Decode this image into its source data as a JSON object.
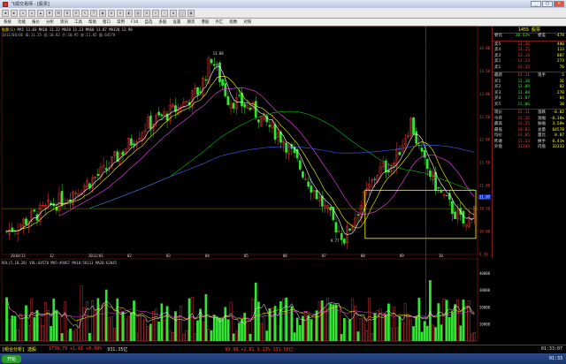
{
  "window": {
    "title": "飞狐交易师 - [股票]",
    "min": "_",
    "max": "□",
    "close": "×"
  },
  "toolbar": {
    "buttons": [
      "◀",
      "▶",
      "⌂",
      "↻",
      "▲",
      "▼",
      "☰",
      "⊞",
      "⊟",
      "✎",
      "?",
      "▣",
      "⊕",
      "⊖",
      "◧",
      "▤",
      "⊡",
      "✦",
      "☆",
      "⚙",
      "□",
      "▦"
    ]
  },
  "menu": {
    "items": [
      "系统",
      "功能",
      "报价",
      "分析",
      "资讯",
      "工具",
      "帮助",
      "窗口",
      "常用",
      "F10",
      "自选",
      "多股",
      "设置",
      "期货",
      "港股",
      "外汇",
      "指数",
      "对照"
    ]
  },
  "indicator_top": {
    "name": "股票(1)",
    "values": "MA5 11.03  MA10 11.22  MA20 11.13  MA60 11.87  MA120 12.98"
  },
  "indicator_sub": {
    "values": "2011/08/06 高:11.25 低:10.83 开:10.95 收:11.05 量:64578"
  },
  "volume_info": {
    "values": "VOL(5,10,20) VOL:64578 MA5:49467 MA10:56113 MA20:62045"
  },
  "chart_labels": {
    "peak": "13.88",
    "low": "9.77",
    "highlight": "11.97"
  },
  "right_panel": {
    "header": "1455 股票",
    "rows": [
      {
        "k": "委比",
        "v": "-30.03%",
        "e": "委差",
        "x": "-478"
      },
      {
        "k": "卖5",
        "v": "11.16",
        "e": "",
        "x": "480"
      },
      {
        "k": "卖4",
        "v": "11.15",
        "e": "",
        "x": "113"
      },
      {
        "k": "卖3",
        "v": "11.14",
        "e": "",
        "x": "887"
      },
      {
        "k": "卖2",
        "v": "11.13",
        "e": "",
        "x": "273"
      },
      {
        "k": "卖1",
        "v": "11.12",
        "e": "",
        "x": "76"
      },
      {
        "k": "最新",
        "v": "11.11",
        "e": "现手",
        "x": "5"
      },
      {
        "k": "买1",
        "v": "11.10",
        "e": "",
        "x": "31"
      },
      {
        "k": "买2",
        "v": "11.09",
        "e": "",
        "x": "82"
      },
      {
        "k": "买3",
        "v": "11.08",
        "e": "",
        "x": "270"
      },
      {
        "k": "买4",
        "v": "11.07",
        "e": "",
        "x": "84"
      },
      {
        "k": "买5",
        "v": "11.06",
        "e": "",
        "x": "10"
      },
      {
        "k": "现价",
        "v": "11.11",
        "e": "涨跌",
        "x": "-0.02"
      },
      {
        "k": "今开",
        "v": "11.12",
        "e": "涨幅",
        "x": "-0.18%"
      },
      {
        "k": "最高",
        "v": "11.25",
        "e": "振幅",
        "x": "3.58%"
      },
      {
        "k": "最低",
        "v": "10.83",
        "e": "总量",
        "x": "64578"
      },
      {
        "k": "均价",
        "v": "11.05",
        "e": "量比",
        "x": "0.87"
      },
      {
        "k": "昨收",
        "v": "11.13",
        "e": "换手",
        "x": "0.41%"
      },
      {
        "k": "外盘",
        "v": "31245",
        "e": "内盘",
        "x": "33333"
      }
    ],
    "date": "2011/10/13",
    "mini_axis": [
      "11.25",
      "11.13",
      "11.00",
      "10.83"
    ]
  },
  "price_axis": [
    "14.00",
    "13.50",
    "13.00",
    "12.50",
    "12.00",
    "11.50",
    "11.00",
    "10.50",
    "10.00",
    "9.50"
  ],
  "vol_axis": [
    "40000",
    "30000",
    "20000",
    "10000"
  ],
  "x_dates": [
    "2010/11",
    "12",
    "2011/01",
    "02",
    "03",
    "04",
    "05",
    "06",
    "07",
    "08",
    "09",
    "10"
  ],
  "status": {
    "left": "[组合分析] 选股",
    "index1": "1738.73 +1.61 +0.09%",
    "index2": "931.35亿",
    "index3": "93.98 +2.81 3.13% 131.56亿",
    "time": "01:33:07"
  },
  "taskbar": {
    "start": "开始",
    "time": "01:33"
  },
  "colors": {
    "up": "#ff3c3c",
    "down": "#32e632",
    "ma5": "#ffffff",
    "ma10": "#ffff00",
    "ma20": "#ff40ff",
    "ma60": "#00c800",
    "ma120": "#4060ff",
    "highlight": "#ffff00"
  }
}
